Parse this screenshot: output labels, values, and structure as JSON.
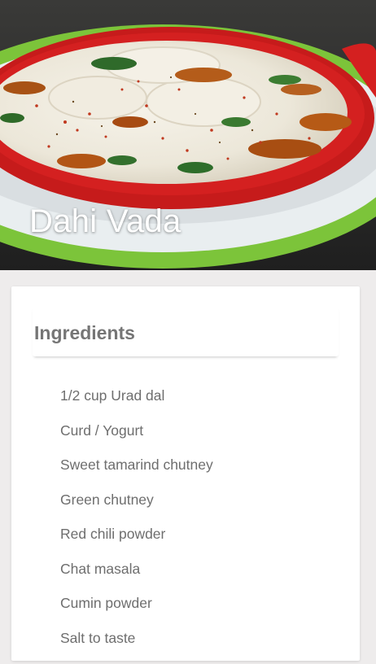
{
  "hero": {
    "title": "Dahi Vada",
    "image_icon": "dahi-vada-photo"
  },
  "ingredients_card": {
    "title": "Ingredients",
    "items": [
      "1/2 cup Urad dal",
      "Curd / Yogurt",
      "Sweet tamarind chutney",
      "Green chutney",
      "Red chili powder",
      "Chat masala",
      "Cumin powder",
      "Salt to taste"
    ]
  },
  "colors": {
    "page_background": "#eeecec",
    "card_background": "#ffffff",
    "title_text": "#757575",
    "item_text": "#6e6e6e",
    "plate_red": "#d42020",
    "plate_green": "#7cc43a"
  }
}
